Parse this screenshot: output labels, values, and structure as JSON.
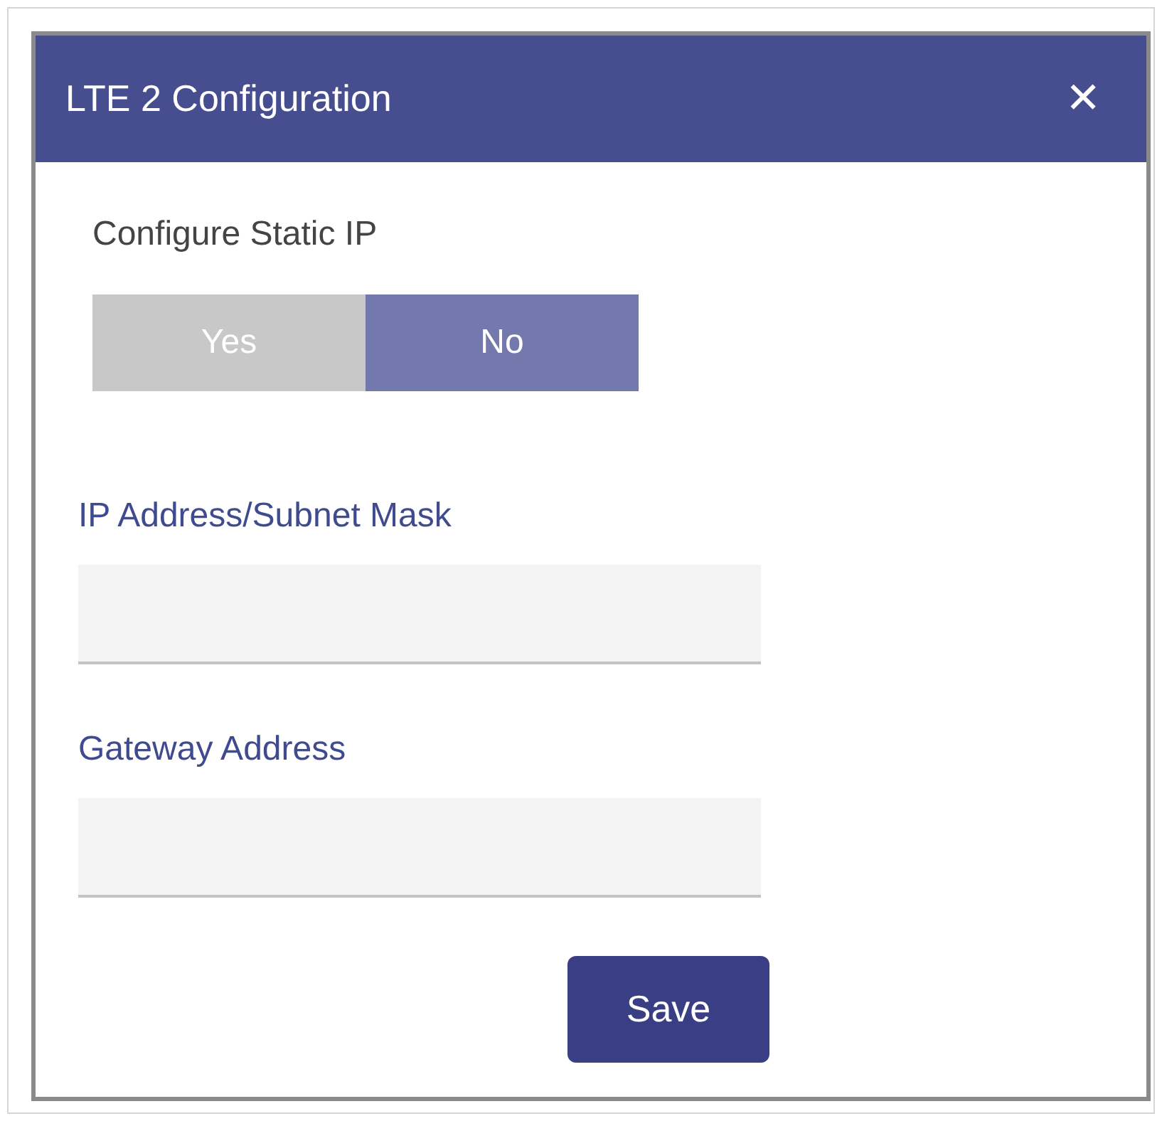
{
  "dialog": {
    "title": "LTE 2 Configuration",
    "close": "✕"
  },
  "static_ip": {
    "label": "Configure Static IP",
    "options": [
      {
        "label": "Yes",
        "selected": false
      },
      {
        "label": "No",
        "selected": true
      }
    ]
  },
  "fields": [
    {
      "label": "IP Address/Subnet Mask"
    },
    {
      "label": "Gateway Address"
    }
  ],
  "buttons": [
    {
      "label": "Save"
    }
  ]
}
